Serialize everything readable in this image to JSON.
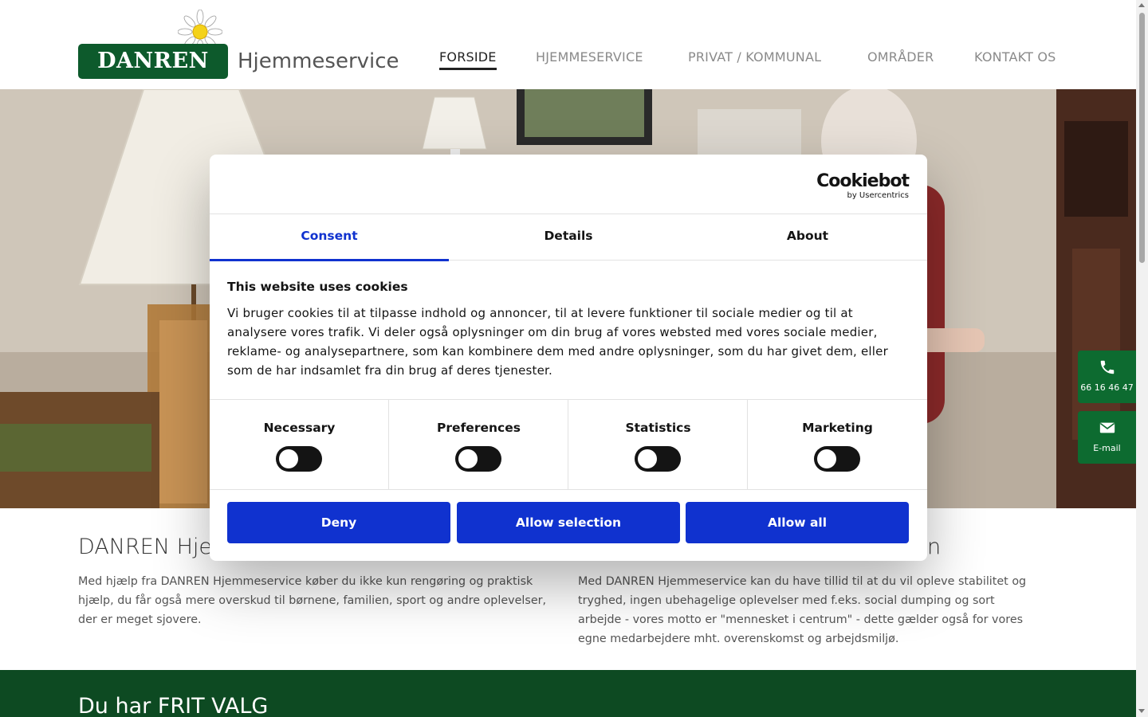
{
  "brand": {
    "badge": "DANREN",
    "sub": "Hjemmeservice",
    "green": "#0d5a2c"
  },
  "nav": [
    {
      "label": "FORSIDE",
      "active": true
    },
    {
      "label": "HJEMMESERVICE",
      "active": false
    },
    {
      "label": "PRIVAT / KOMMUNAL",
      "active": false
    },
    {
      "label": "OMRÅDER",
      "active": false
    },
    {
      "label": "KONTAKT OS",
      "active": false
    }
  ],
  "side": {
    "phone": {
      "icon": "phone-icon",
      "label": "66 16 46 47"
    },
    "email": {
      "icon": "envelope-icon",
      "label": "E-mail"
    }
  },
  "content": {
    "left_title": "DANREN Hje",
    "left_text": "Med hjælp fra DANREN Hjemmeservice køber du ikke kun rengøring og praktisk hjælp, du får også mere overskud til børnene, familien, sport og andre oplevelser, der er meget sjovere.",
    "right_title_tail": "n",
    "right_text": "Med DANREN Hjemmeservice kan du have tillid til at du vil opleve stabilitet og tryghed, ingen ubehagelige oplevelser med f.eks. social dumping og sort arbejde - vores motto er \"mennesket i centrum\" - dette gælder også for vores egne medarbejdere mht. overenskomst og arbejdsmiljø.",
    "band_title": "Du har FRIT VALG"
  },
  "cookie": {
    "logo_main": "Cookiebot",
    "logo_sub": "by Usercentrics",
    "tabs": [
      "Consent",
      "Details",
      "About"
    ],
    "title": "This website uses cookies",
    "text": "Vi bruger cookies til at tilpasse indhold og annoncer, til at levere funktioner til sociale medier og til at analysere vores trafik. Vi deler også oplysninger om din brug af vores websted med vores sociale medier, reklame- og analysepartnere, som kan kombinere dem med andre oplysninger, som du har givet dem, eller som de har indsamlet fra din brug af deres tjenester.",
    "categories": [
      {
        "label": "Necessary",
        "checked": false
      },
      {
        "label": "Preferences",
        "checked": false
      },
      {
        "label": "Statistics",
        "checked": false
      },
      {
        "label": "Marketing",
        "checked": false
      }
    ],
    "buttons": {
      "deny": "Deny",
      "allow_selection": "Allow selection",
      "allow_all": "Allow all"
    },
    "accent": "#1032cf"
  }
}
